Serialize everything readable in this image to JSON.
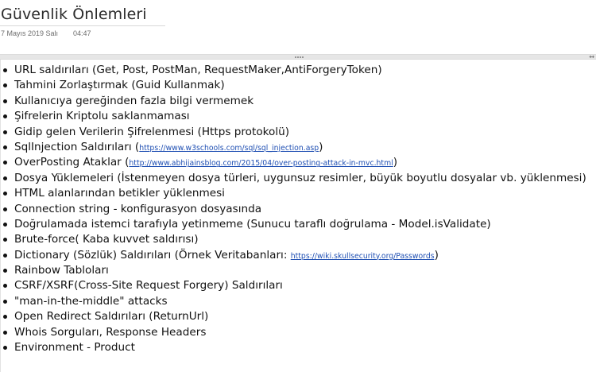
{
  "page": {
    "title": "Güvenlik Önlemleri",
    "date": "7 Mayıs 2019 Salı",
    "time": "04:47"
  },
  "items": [
    {
      "text": "URL saldırıları (Get, Post, PostMan, RequestMaker,AntiForgeryToken)"
    },
    {
      "text": "Tahmini Zorlaştırmak (Guid Kullanmak)"
    },
    {
      "text": "Kullanıcıya gereğinden fazla bilgi vermemek"
    },
    {
      "text": "Şifrelerin Kriptolu saklanmaması"
    },
    {
      "text": "Gidip gelen Verilerin Şifrelenmesi (Https protokolü)"
    },
    {
      "text": "SqlInjection Saldırıları (",
      "link": "https://www.w3schools.com/sql/sql_injection.asp",
      "after": ")"
    },
    {
      "text": "OverPosting Ataklar (",
      "link": "http://www.abhijainsblog.com/2015/04/over-posting-attack-in-mvc.html",
      "after": ")"
    },
    {
      "text": "Dosya Yüklemeleri (İstenmeyen dosya türleri, uygunsuz resimler, büyük boyutlu dosyalar vb.  yüklenmesi)"
    },
    {
      "text": "HTML alanlarından betikler yüklenmesi"
    },
    {
      "text": "Connection string - konfigurasyon dosyasında"
    },
    {
      "text": "Doğrulamada istemci tarafıyla yetinmeme (Sunucu taraflı doğrulama - Model.isValidate)"
    },
    {
      "text": "Brute-force( Kaba kuvvet saldırısı)"
    },
    {
      "text": "Dictionary (Sözlük) Saldırıları (Örnek Veritabanları: ",
      "link": "https://wiki.skullsecurity.org/Passwords",
      "after": ")"
    },
    {
      "text": "Rainbow Tabloları"
    },
    {
      "text": "CSRF/XSRF(Cross-Site Request Forgery) Saldırıları"
    },
    {
      "text": "\"man-in-the-middle\" attacks"
    },
    {
      "text": "Open Redirect Saldırıları (ReturnUrl)"
    },
    {
      "text": "Whois Sorguları, Response Headers"
    },
    {
      "text": "Environment - Product"
    }
  ]
}
